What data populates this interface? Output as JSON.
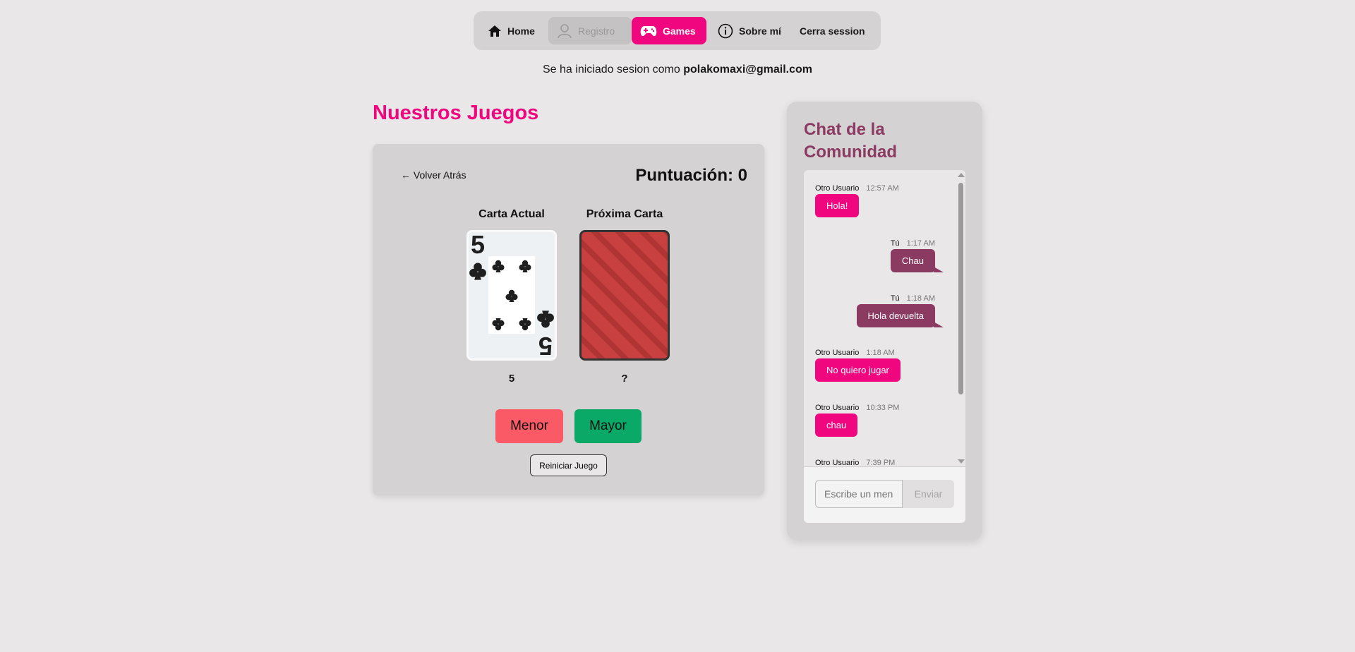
{
  "nav": {
    "items": [
      {
        "label": "Home",
        "icon": "home-icon"
      },
      {
        "label": "Registro",
        "icon": "user-icon"
      },
      {
        "label": "Games",
        "icon": "gamepad-icon"
      },
      {
        "label": "Sobre mí",
        "icon": "info-icon"
      },
      {
        "label": "Cerra session"
      }
    ]
  },
  "session": {
    "prefix": "Se ha iniciado sesion como",
    "email": "polakomaxi@gmail.com"
  },
  "games": {
    "title": "Nuestros Juegos",
    "back_label": "← Volver Atrás",
    "score_label": "Puntuación: 0",
    "current_card_label": "Carta Actual",
    "next_card_label": "Próxima Carta",
    "current_card_rank": "5",
    "current_card_suit": "clubs",
    "current_card_value": "5",
    "next_card_value": "?",
    "lower_label": "Menor",
    "higher_label": "Mayor",
    "reset_label": "Reiniciar Juego"
  },
  "chat": {
    "title": "Chat de la Comunidad",
    "messages": [
      {
        "user": "Otro Usuario",
        "time": "12:57 AM",
        "text": "Hola!"
      },
      {
        "user": "Tú",
        "time": "1:17 AM",
        "text": "Chau"
      },
      {
        "user": "Tú",
        "time": "1:18 AM",
        "text": "Hola devuelta"
      },
      {
        "user": "Otro Usuario",
        "time": "1:18 AM",
        "text": "No quiero jugar"
      },
      {
        "user": "Otro Usuario",
        "time": "10:33 PM",
        "text": "chau"
      },
      {
        "user": "Otro Usuario",
        "time": "7:39 PM",
        "text": ""
      }
    ],
    "input_placeholder": "Escribe un mensaje...",
    "send_label": "Enviar"
  },
  "colors": {
    "accent": "#f0077f",
    "chat_accent": "#8b3a62",
    "lower_button": "#f95a66",
    "higher_button": "#0aa968"
  }
}
